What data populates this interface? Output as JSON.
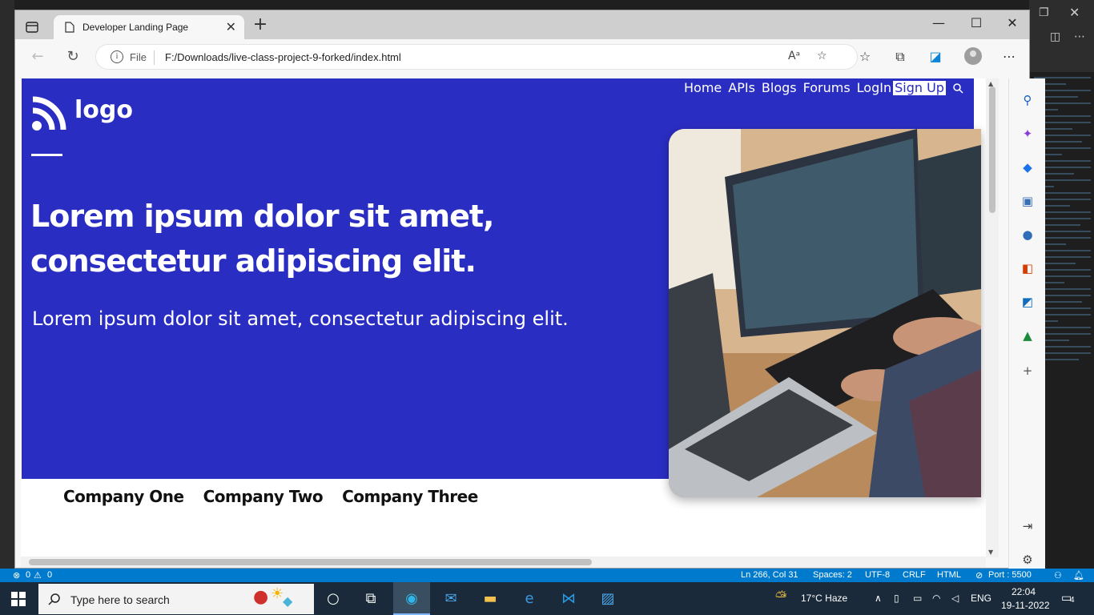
{
  "browser": {
    "tab_title": "Developer Landing Page",
    "address_prefix": "File",
    "url": "F:/Downloads/live-class-project-9-forked/index.html"
  },
  "page": {
    "logo_text": "logo",
    "nav": [
      "Home",
      "APIs",
      "Blogs",
      "Forums",
      "LogIn"
    ],
    "signup": "Sign Up",
    "headline": "Lorem ipsum dolor sit amet, consectetur adipiscing elit.",
    "subline": "Lorem ipsum dolor sit amet, consectetur adipiscing elit.",
    "companies": [
      "Company One",
      "Company Two",
      "Company Three"
    ],
    "colors": {
      "hero": "#2a2dc2"
    }
  },
  "statusbar": {
    "errors": "0",
    "warnings": "0",
    "position": "Ln 266, Col 31",
    "spaces": "Spaces: 2",
    "encoding": "UTF-8",
    "eol": "CRLF",
    "language": "HTML",
    "port": "Port : 5500"
  },
  "taskbar": {
    "search_placeholder": "Type here to search",
    "weather": "17°C  Haze",
    "lang": "ENG",
    "time": "22:04",
    "date": "19-11-2022",
    "notifications": "4"
  }
}
